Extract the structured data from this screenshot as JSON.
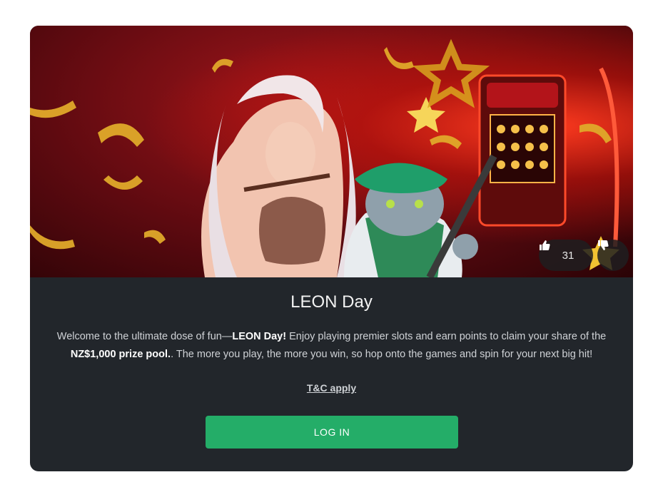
{
  "promo": {
    "title": "LEON Day",
    "description": {
      "part1": "Welcome to the ultimate dose of fun—",
      "bold1": "LEON Day!",
      "part2": " Enjoy playing premier slots and earn points to claim your share of the ",
      "bold2": "NZ$1,000 prize pool.",
      "part3": ". The more you play, the more you win, so hop onto the games and spin for your next big hit!"
    },
    "terms_link": "T&C apply",
    "login_button": "LOG IN"
  },
  "votes": {
    "like_count": "31",
    "like_icon": "thumbs-up-icon",
    "dislike_icon": "thumbs-down-icon"
  },
  "colors": {
    "card_bg": "#22262b",
    "button_green": "#24ad68"
  }
}
